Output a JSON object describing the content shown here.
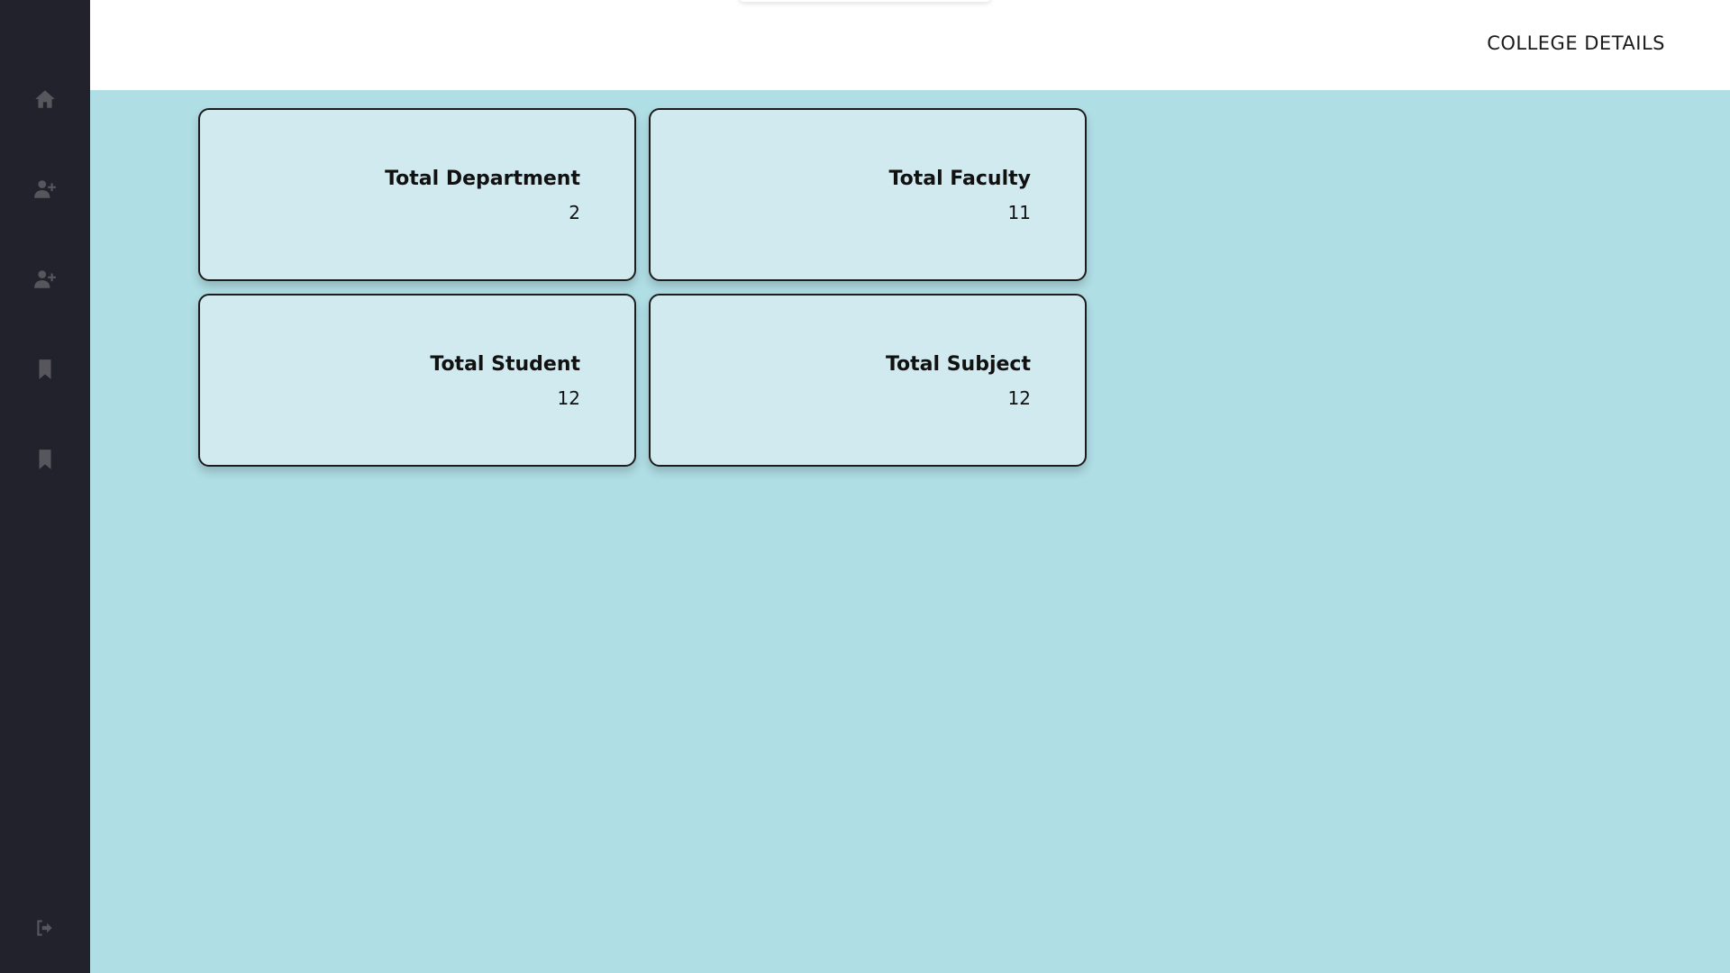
{
  "header": {
    "title": "COLLEGE DETAILS"
  },
  "sidebar": {
    "items": [
      {
        "icon": "home-icon"
      },
      {
        "icon": "user-plus-icon"
      },
      {
        "icon": "user-plus-icon"
      },
      {
        "icon": "bookmark-icon"
      },
      {
        "icon": "bookmark-icon"
      }
    ],
    "logout_icon": "sign-out-icon"
  },
  "cards": [
    {
      "title": "Total Department",
      "value": "2"
    },
    {
      "title": "Total Faculty",
      "value": "11"
    },
    {
      "title": "Total Student",
      "value": "12"
    },
    {
      "title": "Total Subject",
      "value": "12"
    }
  ],
  "colors": {
    "sidebar": "#22222c",
    "background": "#b0dee5",
    "card": "#d1eaef",
    "icon": "#56565c"
  }
}
